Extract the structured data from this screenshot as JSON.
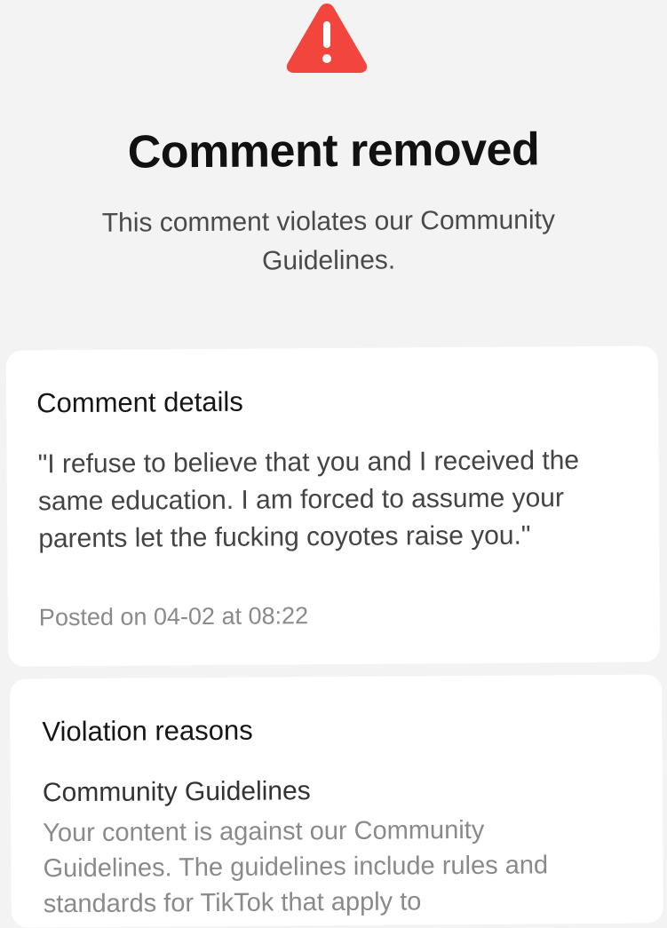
{
  "header": {
    "icon": "warning-triangle-icon",
    "icon_color": "#f1453d",
    "title": "Comment removed",
    "subtitle": "This comment violates our Community Guidelines."
  },
  "comment_details": {
    "heading": "Comment details",
    "text": "\"I refuse to believe that you and I received the same education. I am forced to assume your parents let the fucking coyotes raise you.\"",
    "posted": "Posted on 04-02 at 08:22"
  },
  "violation": {
    "heading": "Violation reasons",
    "reason_title": "Community Guidelines",
    "reason_description": "Your content is against our Community Guidelines. The guidelines include rules and standards for TikTok that apply to"
  }
}
